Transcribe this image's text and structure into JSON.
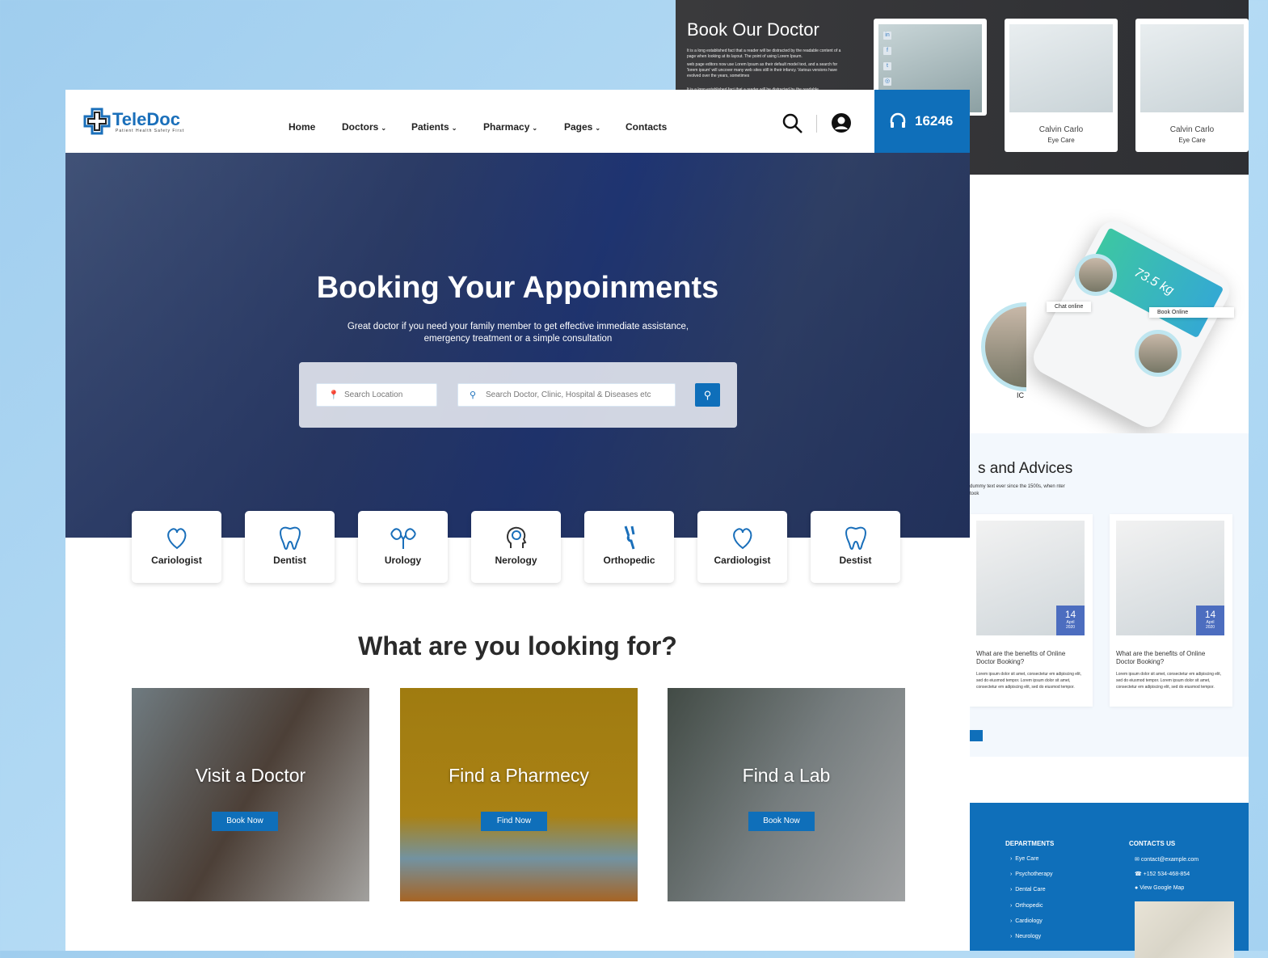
{
  "back_panel": {
    "title": "Book Our Doctor",
    "paragraphs": [
      "It is a long established fact that a reader will be distracted by the readable content of a page when looking at its layout. The point of using Lorem Ipsum.",
      "web page editors now use Lorem Ipsum as their default model text, and a search for 'lorem ipsum' will uncover many web sites still in their infancy. Various versions have evolved over the years, sometimes",
      "It is a long established fact that a reader will be distracted by the readable"
    ],
    "doctors": [
      {
        "name": "Calvin Carlo",
        "specialty": "Eye Care"
      },
      {
        "name": "Calvin Carlo",
        "specialty": "Eye Care"
      }
    ],
    "social": [
      "linkedin-icon",
      "facebook-icon",
      "twitter-icon",
      "instagram-icon"
    ],
    "app": {
      "weight": "73.5 kg",
      "chat_label": "Chat online",
      "book_label": "Book Online",
      "caption": "IC"
    },
    "blog": {
      "title": "s and Advices",
      "subtitle": "dummy text ever since the 1500s, when nter took",
      "posts": [
        {
          "day": "14",
          "month": "April",
          "year": "2020",
          "title": "What are the benefits of Online Doctor Booking?",
          "body": "Lorem ipsum dolor sit amet, consectetur em adipiscing elit, sed do eiusmod tempor. Lorem ipsum dolor sit amet, consectetur em adipiscing elit, sed do eiusmod tempor."
        },
        {
          "day": "14",
          "month": "April",
          "year": "2020",
          "title": "What are the benefits of Online Doctor Booking?",
          "body": "Lorem ipsum dolor sit amet, consectetur em adipiscing elit, sed do eiusmod tempor. Lorem ipsum dolor sit amet, consectetur em adipiscing elit, sed do eiusmod tempor."
        }
      ]
    },
    "footer": {
      "departments_title": "DEPARTMENTS",
      "departments": [
        "Eye Care",
        "Psychotherapy",
        "Dental Care",
        "Orthopedic",
        "Cardiology",
        "Neurology"
      ],
      "contacts_title": "CONTACTS US",
      "email": "contact@example.com",
      "phone": "+152 534-468-854",
      "map_link": "View Google Map"
    }
  },
  "header": {
    "brand": "TeleDoc",
    "tagline": "Patient Health Safety First",
    "nav": [
      {
        "label": "Home"
      },
      {
        "label": "Doctors",
        "dropdown": true
      },
      {
        "label": "Patients",
        "dropdown": true
      },
      {
        "label": "Pharmacy",
        "dropdown": true
      },
      {
        "label": "Pages",
        "dropdown": true
      },
      {
        "label": "Contacts"
      }
    ],
    "hotline": "16246"
  },
  "hero": {
    "title": "Booking Your Appoinments",
    "subtitle": "Great doctor if you need your family member to get effective immediate assistance, emergency treatment or a simple consultation",
    "location_placeholder": "Search Location",
    "search_placeholder": "Search Doctor, Clinic, Hospital & Diseases etc"
  },
  "categories": [
    "Cariologist",
    "Dentist",
    "Urology",
    "Nerology",
    "Orthopedic",
    "Cardiologist",
    "Destist"
  ],
  "looking": {
    "heading": "What are you looking for?",
    "cards": [
      {
        "title": "Visit a Doctor",
        "button": "Book Now"
      },
      {
        "title": "Find a Pharmecy",
        "button": "Find Now"
      },
      {
        "title": "Find a Lab",
        "button": "Book Now"
      }
    ]
  },
  "colors": {
    "primary": "#0f6fba",
    "date_badge": "#4c6dbf",
    "background": "#a8d3f0"
  }
}
